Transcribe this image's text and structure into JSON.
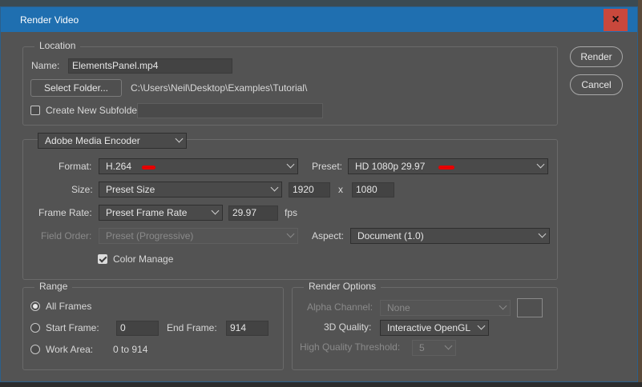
{
  "window": {
    "title": "Render Video",
    "close_glyph": "×"
  },
  "actions": {
    "render": "Render",
    "cancel": "Cancel"
  },
  "location": {
    "legend": "Location",
    "name_label": "Name:",
    "name_value": "ElementsPanel.mp4",
    "select_folder": "Select Folder...",
    "folder_path": "C:\\Users\\Neil\\Desktop\\Examples\\Tutorial\\",
    "subfolder_label": "Create New Subfolder:",
    "subfolder_checked": false,
    "subfolder_value": ""
  },
  "encoder": {
    "engine": "Adobe Media Encoder",
    "format_label": "Format:",
    "format_value": "H.264",
    "preset_label": "Preset:",
    "preset_value": "HD 1080p 29.97",
    "size_label": "Size:",
    "size_value": "Preset Size",
    "width": "1920",
    "x_sep": "x",
    "height": "1080",
    "frame_rate_label": "Frame Rate:",
    "frame_rate_value": "Preset Frame Rate",
    "fps_value": "29.97",
    "fps_unit": "fps",
    "field_order_label": "Field Order:",
    "field_order_value": "Preset (Progressive)",
    "aspect_label": "Aspect:",
    "aspect_value": "Document (1.0)",
    "color_manage_label": "Color Manage",
    "color_manage_checked": true,
    "redaction_color": "#e60000"
  },
  "range": {
    "legend": "Range",
    "all_frames": "All Frames",
    "start_frame_label": "Start Frame:",
    "start_frame": "0",
    "end_frame_label": "End Frame:",
    "end_frame": "914",
    "work_area_label": "Work Area:",
    "work_area_value": "0 to 914",
    "selected": "All Frames"
  },
  "render_options": {
    "legend": "Render Options",
    "alpha_label": "Alpha Channel:",
    "alpha_value": "None",
    "quality_label": "3D Quality:",
    "quality_value": "Interactive OpenGL",
    "threshold_label": "High Quality Threshold:",
    "threshold_value": "5"
  },
  "colors": {
    "titlebar": "#1f6fb0",
    "close": "#c9483c",
    "dialog_bg": "#535353"
  }
}
